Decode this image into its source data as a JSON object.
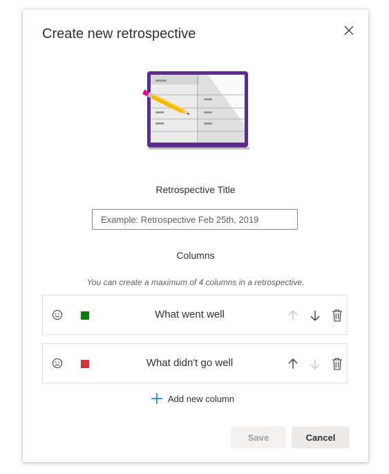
{
  "dialog": {
    "title": "Create new retrospective",
    "title_label": "Retrospective Title",
    "title_input": {
      "value": "",
      "placeholder": "Example: Retrospective Feb 25th, 2019"
    },
    "columns_label": "Columns",
    "columns_hint": "You can create a maximum of 4 columns in a retrospective.",
    "columns": [
      {
        "icon": "smile-icon",
        "color": "#107c10",
        "name": "What went well",
        "move_up_enabled": false,
        "move_down_enabled": true
      },
      {
        "icon": "frown-icon",
        "color": "#d13438",
        "name": "What didn't go well",
        "move_up_enabled": true,
        "move_down_enabled": false
      }
    ],
    "add_column_label": "Add new column",
    "save_label": "Save",
    "cancel_label": "Cancel",
    "save_enabled": false
  },
  "colors": {
    "accent": "#0078d4",
    "illustration_frame": "#5c2d91"
  }
}
